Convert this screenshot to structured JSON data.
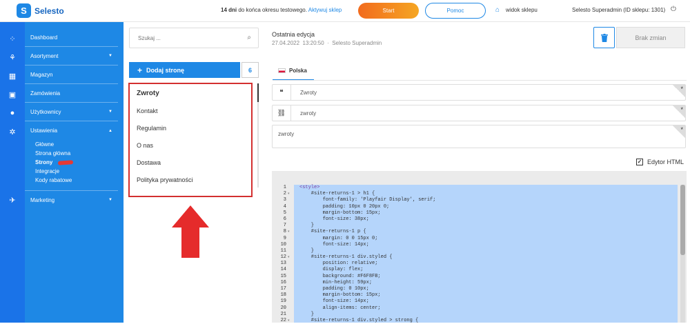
{
  "topbar": {
    "logo_text": "Selesto",
    "trial_bold": "14 dni",
    "trial_text": " do końca okresu testowego.",
    "trial_link": "Aktywuj sklep",
    "start_label": "Start",
    "help_label": "Pomoc",
    "view_shop_label": "widok sklepu",
    "admin_label": "Selesto Superadmin (ID sklepu: 1301)"
  },
  "sidebar": {
    "items": [
      {
        "label": "Dashboard",
        "caret": ""
      },
      {
        "label": "Asortyment",
        "caret": "▼"
      },
      {
        "label": "Magazyn",
        "caret": ""
      },
      {
        "label": "Zamówienia",
        "caret": ""
      },
      {
        "label": "Użytkownicy",
        "caret": "▼"
      },
      {
        "label": "Ustawienia",
        "caret": "▲"
      }
    ],
    "sub_items": [
      "Główne",
      "Strona główna",
      "Strony",
      "Integracje",
      "Kody rabatowe"
    ],
    "marketing": {
      "label": "Marketing",
      "caret": "▼"
    }
  },
  "pages": {
    "search_placeholder": "Szukaj ...",
    "add_label": "Dodaj stronę",
    "count": "6",
    "list": [
      "Zwroty",
      "Kontakt",
      "Regulamin",
      "O nas",
      "Dostawa",
      "Polityka prywatności"
    ]
  },
  "editor": {
    "last_edit_title": "Ostatnia edycja",
    "last_edit_date": "27.04.2022",
    "last_edit_time": "13:20:50",
    "last_edit_user": "Selesto Superadmin",
    "no_changes_label": "Brak zmian",
    "lang_tab": "Polska",
    "title_value": "Zwroty",
    "slug_value": "zwroty",
    "description_value": "zwroty",
    "required_mark": "*",
    "html_editor_label": "Edytor HTML",
    "checkbox_mark": "✓"
  },
  "code": {
    "lines": [
      {
        "n": "1",
        "f": "",
        "t": "<style>"
      },
      {
        "n": "2",
        "f": "▾",
        "t": "    #site-returns-1 > h1 {"
      },
      {
        "n": "3",
        "f": "",
        "t": "        font-family: 'Playfair Display', serif;"
      },
      {
        "n": "4",
        "f": "",
        "t": "        padding: 10px 0 20px 0;"
      },
      {
        "n": "5",
        "f": "",
        "t": "        margin-bottom: 15px;"
      },
      {
        "n": "6",
        "f": "",
        "t": "        font-size: 38px;"
      },
      {
        "n": "7",
        "f": "",
        "t": "    }"
      },
      {
        "n": "8",
        "f": "▾",
        "t": "    #site-returns-1 p {"
      },
      {
        "n": "9",
        "f": "",
        "t": "        margin: 0 0 15px 0;"
      },
      {
        "n": "10",
        "f": "",
        "t": "        font-size: 14px;"
      },
      {
        "n": "11",
        "f": "",
        "t": "    }"
      },
      {
        "n": "12",
        "f": "▾",
        "t": "    #site-returns-1 div.styled {"
      },
      {
        "n": "13",
        "f": "",
        "t": "        position: relative;"
      },
      {
        "n": "14",
        "f": "",
        "t": "        display: flex;"
      },
      {
        "n": "15",
        "f": "",
        "t": "        background: #F6F8FB;"
      },
      {
        "n": "16",
        "f": "",
        "t": "        min-height: 59px;"
      },
      {
        "n": "17",
        "f": "",
        "t": "        padding: 0 10px;"
      },
      {
        "n": "18",
        "f": "",
        "t": "        margin-bottom: 15px;"
      },
      {
        "n": "19",
        "f": "",
        "t": "        font-size: 14px;"
      },
      {
        "n": "20",
        "f": "",
        "t": "        align-items: center;"
      },
      {
        "n": "21",
        "f": "",
        "t": "    }"
      },
      {
        "n": "22",
        "f": "▾",
        "t": "    #site-returns-1 div.styled > strong {"
      }
    ]
  },
  "colors": {
    "brand": "#1e88e5",
    "highlight": "#d32f2f",
    "start_gradient": "#f26b1d"
  },
  "icons": {
    "search": "search-icon",
    "plus": "plus-icon",
    "quote": "quote-icon",
    "link": "link-icon",
    "trash": "trash-icon",
    "home": "home-icon",
    "power": "power-icon"
  }
}
